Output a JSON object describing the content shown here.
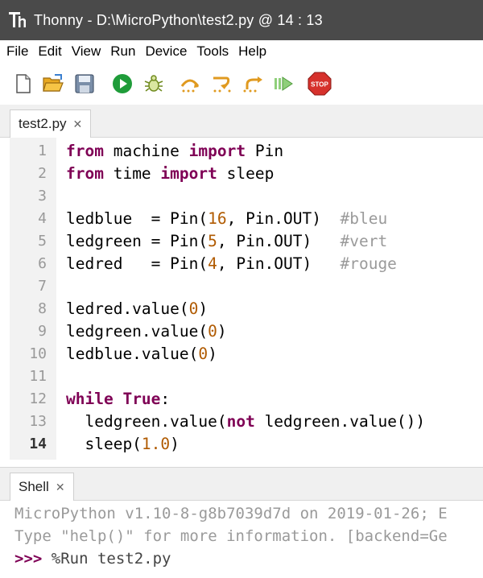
{
  "window": {
    "title": "Thonny  -  D:\\MicroPython\\test2.py  @  14 : 13"
  },
  "menu": [
    "File",
    "Edit",
    "View",
    "Run",
    "Device",
    "Tools",
    "Help"
  ],
  "toolbar": {
    "icons": [
      "new-file-icon",
      "open-folder-icon",
      "save-icon",
      "run-icon",
      "debug-icon",
      "step-over-icon",
      "step-into-icon",
      "step-out-icon",
      "resume-icon",
      "stop-icon"
    ],
    "stop_label": "STOP"
  },
  "editor": {
    "tab_label": "test2.py",
    "tab_close": "✕",
    "current_line": 14,
    "line_numbers": [
      "1",
      "2",
      "3",
      "4",
      "5",
      "6",
      "7",
      "8",
      "9",
      "10",
      "11",
      "12",
      "13",
      "14"
    ],
    "lines": {
      "l1": {
        "kw1": "from",
        "t1": " machine ",
        "kw2": "import",
        "t2": " Pin"
      },
      "l2": {
        "kw1": "from",
        "t1": " time ",
        "kw2": "import",
        "t2": " sleep"
      },
      "l4": {
        "t1": "ledblue  = Pin(",
        "n1": "16",
        "t2": ", Pin.OUT)  ",
        "c": "#bleu"
      },
      "l5": {
        "t1": "ledgreen = Pin(",
        "n1": "5",
        "t2": ", Pin.OUT)   ",
        "c": "#vert"
      },
      "l6": {
        "t1": "ledred   = Pin(",
        "n1": "4",
        "t2": ", Pin.OUT)   ",
        "c": "#rouge"
      },
      "l8": {
        "t1": "ledred.value(",
        "n1": "0",
        "t2": ")"
      },
      "l9": {
        "t1": "ledgreen.value(",
        "n1": "0",
        "t2": ")"
      },
      "l10": {
        "t1": "ledblue.value(",
        "n1": "0",
        "t2": ")"
      },
      "l12": {
        "kw1": "while",
        "t1": " ",
        "kw2": "True",
        "t2": ":"
      },
      "l13": {
        "t1": "  ledgreen.value(",
        "kw1": "not",
        "t2": " ledgreen.value())"
      },
      "l14": {
        "t1": "  sleep(",
        "n1": "1.0",
        "t2": ")"
      }
    }
  },
  "shell": {
    "tab_label": "Shell",
    "tab_close": "✕",
    "line1": "MicroPython v1.10-8-g8b7039d7d on 2019-01-26; E",
    "line2": "Type \"help()\" for more information. [backend=Ge",
    "prompt": ">>>",
    "command": " %Run test2.py"
  },
  "colors": {
    "titlebar_bg": "#4a4a4a",
    "keyword": "#7f0055",
    "number": "#b05a00",
    "comment": "#9a9a9a",
    "gutter_bg": "#f2f2f2"
  }
}
